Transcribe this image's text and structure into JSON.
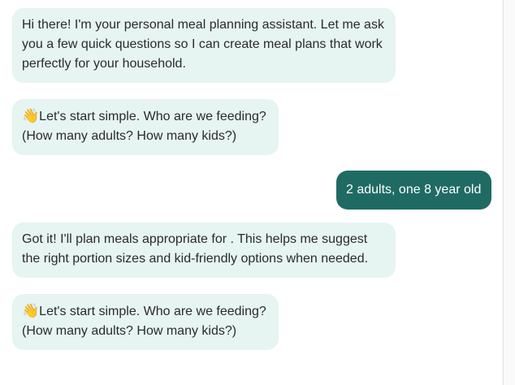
{
  "messages": [
    {
      "role": "assistant",
      "lines": [
        "Hi there! I'm your personal meal planning assistant. Let me ask",
        "you a few quick questions so I can create meal plans that work",
        "perfectly for your household."
      ]
    },
    {
      "role": "assistant",
      "emoji": "👋",
      "lines": [
        "Let's start simple. Who are we feeding?",
        "(How many adults? How many kids?)"
      ]
    },
    {
      "role": "user",
      "text": "2 adults, one 8 year old"
    },
    {
      "role": "assistant",
      "lines": [
        "Got it! I'll plan meals appropriate for . This helps me suggest",
        "the right portion sizes and kid-friendly options when needed."
      ]
    },
    {
      "role": "assistant",
      "emoji": "👋",
      "lines": [
        "Let's start simple. Who are we feeding?",
        "(How many adults? How many kids?)"
      ]
    }
  ],
  "colors": {
    "assistant_bubble": "#e6f4f2",
    "user_bubble": "#1f6b63",
    "assistant_text": "#2b2b2b",
    "user_text": "#ffffff"
  }
}
